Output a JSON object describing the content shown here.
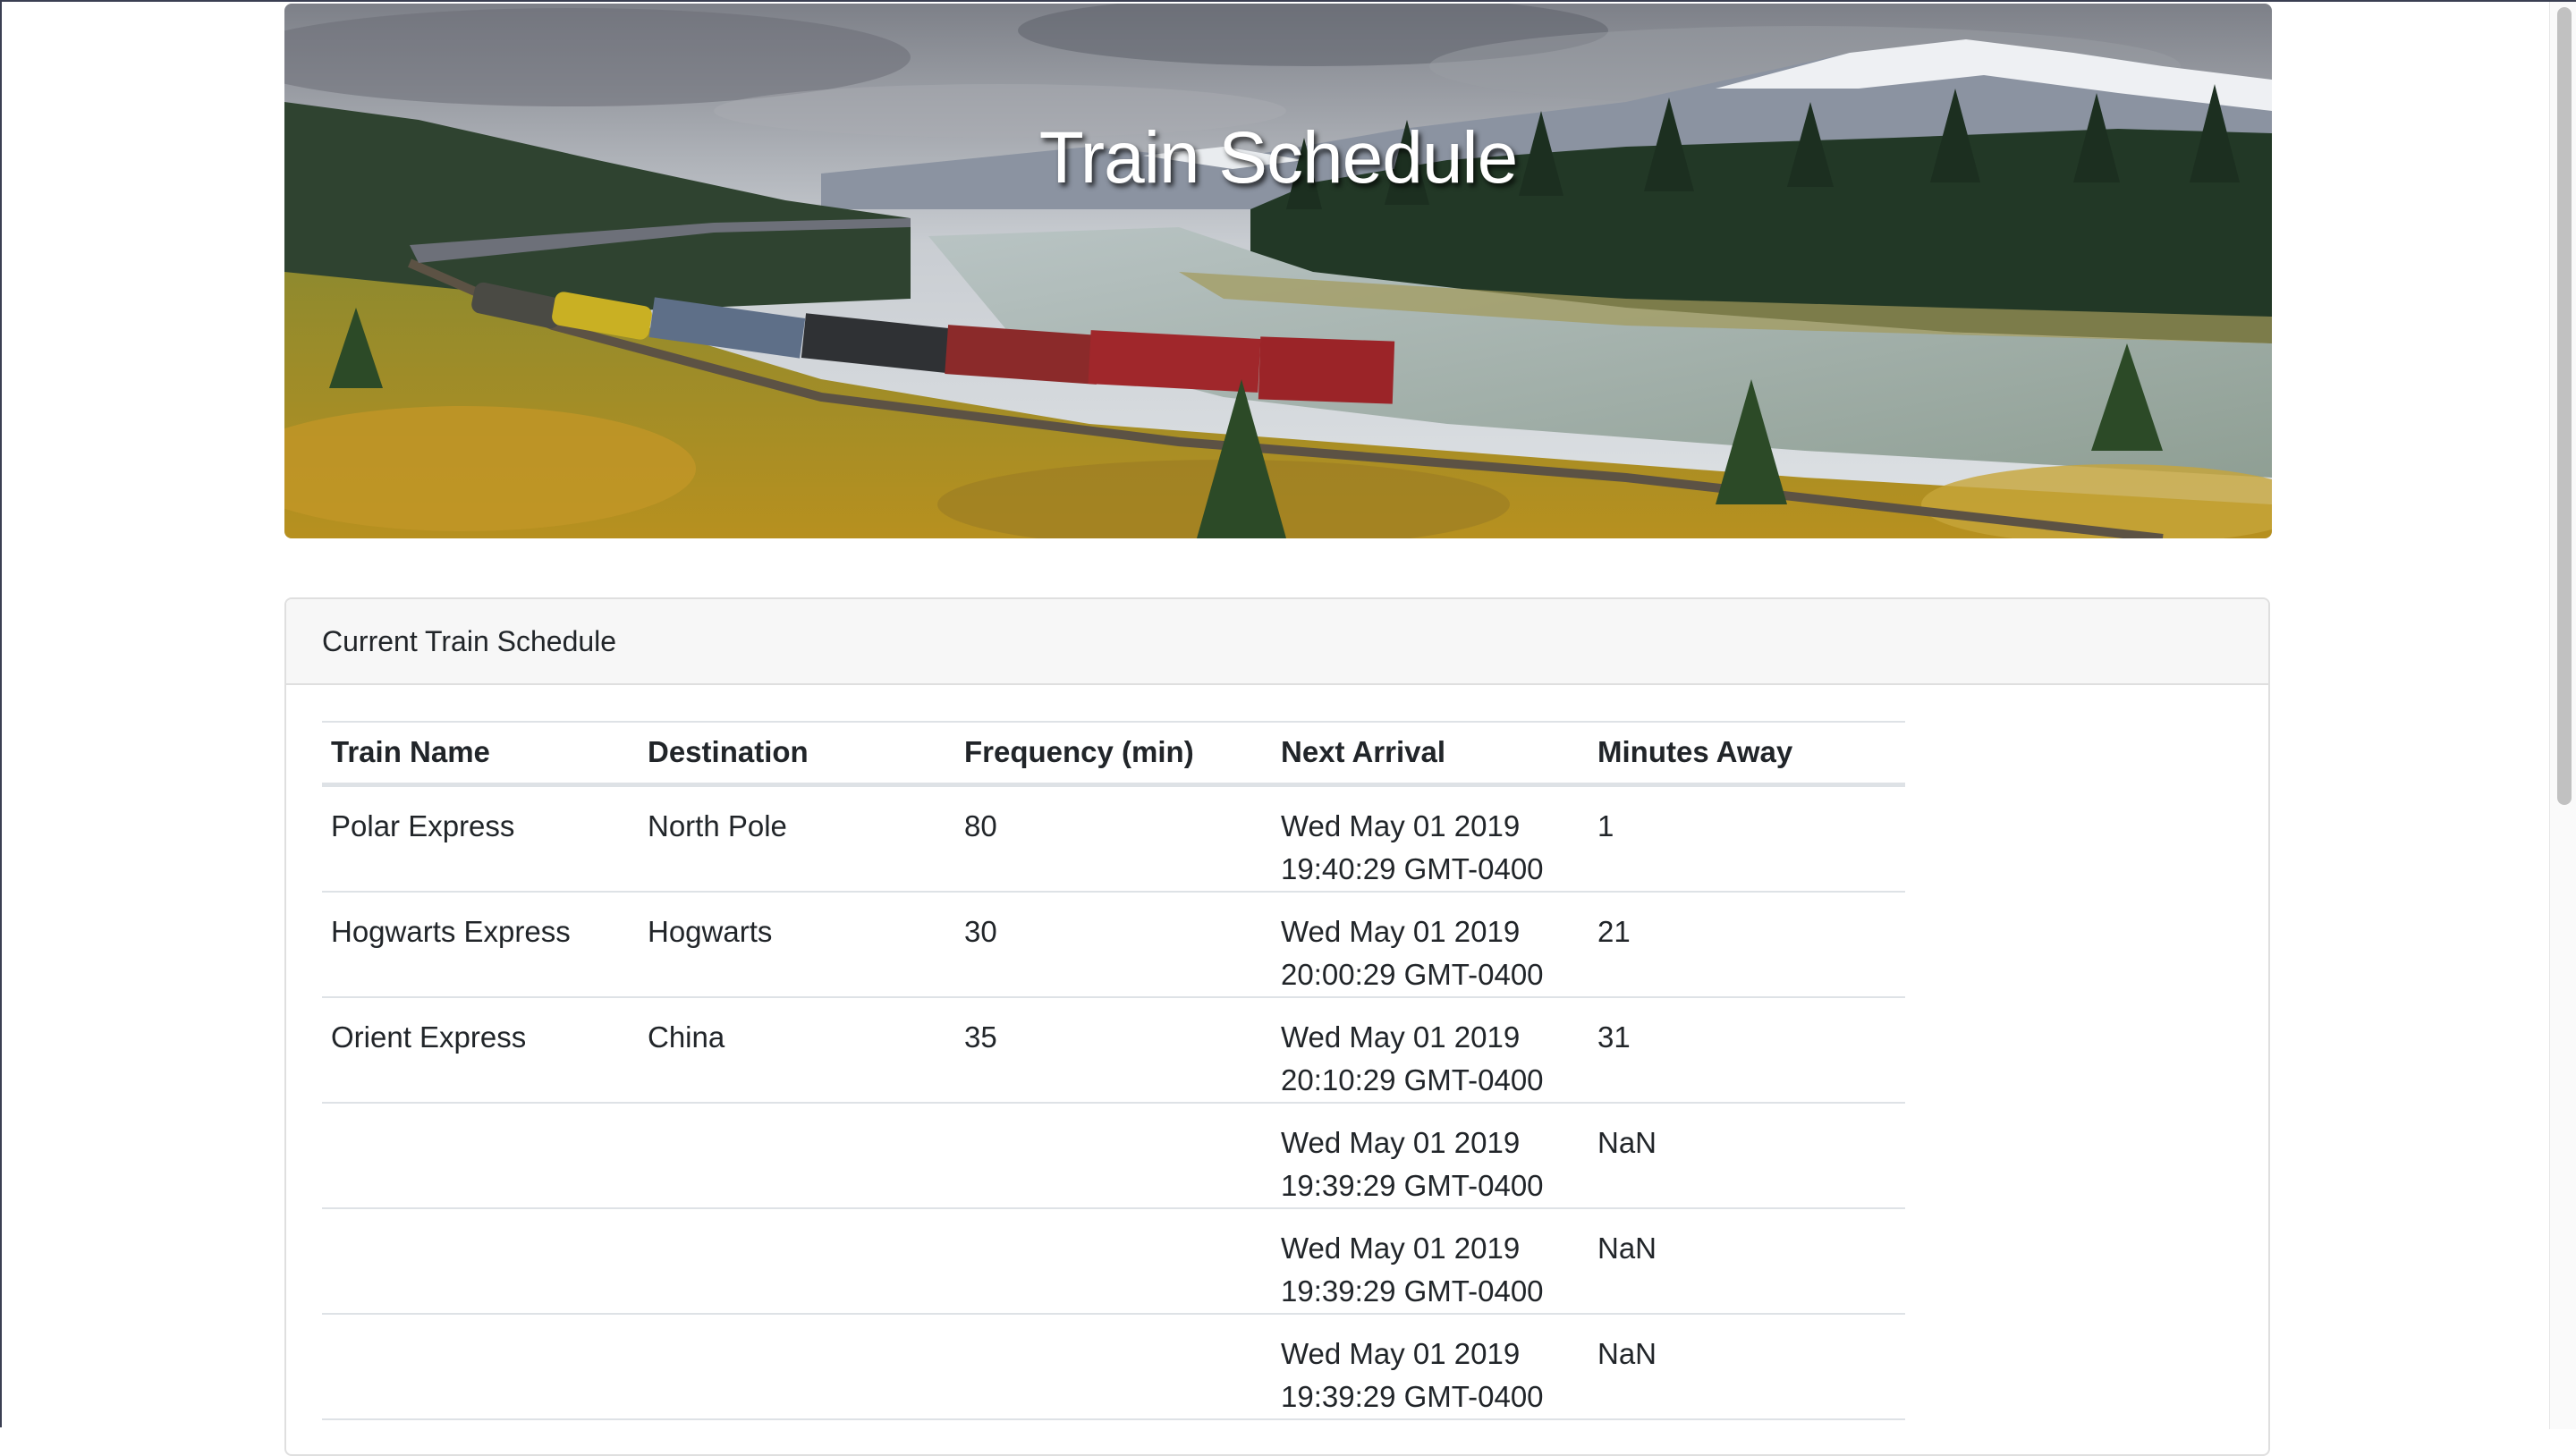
{
  "header": {
    "title": "Train Schedule",
    "image": "mountain-river-train-photo"
  },
  "card": {
    "title": "Current Train Schedule"
  },
  "table": {
    "columns": [
      "Train Name",
      "Destination",
      "Frequency (min)",
      "Next Arrival",
      "Minutes Away"
    ],
    "rows": [
      {
        "name": "Polar Express",
        "destination": "North Pole",
        "frequency": "80",
        "arrival_date": "Wed May 01 2019",
        "arrival_time": "19:40:29 GMT-0400",
        "minutes_away": "1"
      },
      {
        "name": "Hogwarts Express",
        "destination": "Hogwarts",
        "frequency": "30",
        "arrival_date": "Wed May 01 2019",
        "arrival_time": "20:00:29 GMT-0400",
        "minutes_away": "21"
      },
      {
        "name": "Orient Express",
        "destination": "China",
        "frequency": "35",
        "arrival_date": "Wed May 01 2019",
        "arrival_time": "20:10:29 GMT-0400",
        "minutes_away": "31"
      },
      {
        "name": "",
        "destination": "",
        "frequency": "",
        "arrival_date": "Wed May 01 2019",
        "arrival_time": "19:39:29 GMT-0400",
        "minutes_away": "NaN"
      },
      {
        "name": "",
        "destination": "",
        "frequency": "",
        "arrival_date": "Wed May 01 2019",
        "arrival_time": "19:39:29 GMT-0400",
        "minutes_away": "NaN"
      },
      {
        "name": "",
        "destination": "",
        "frequency": "",
        "arrival_date": "Wed May 01 2019",
        "arrival_time": "19:39:29 GMT-0400",
        "minutes_away": "NaN"
      }
    ]
  }
}
